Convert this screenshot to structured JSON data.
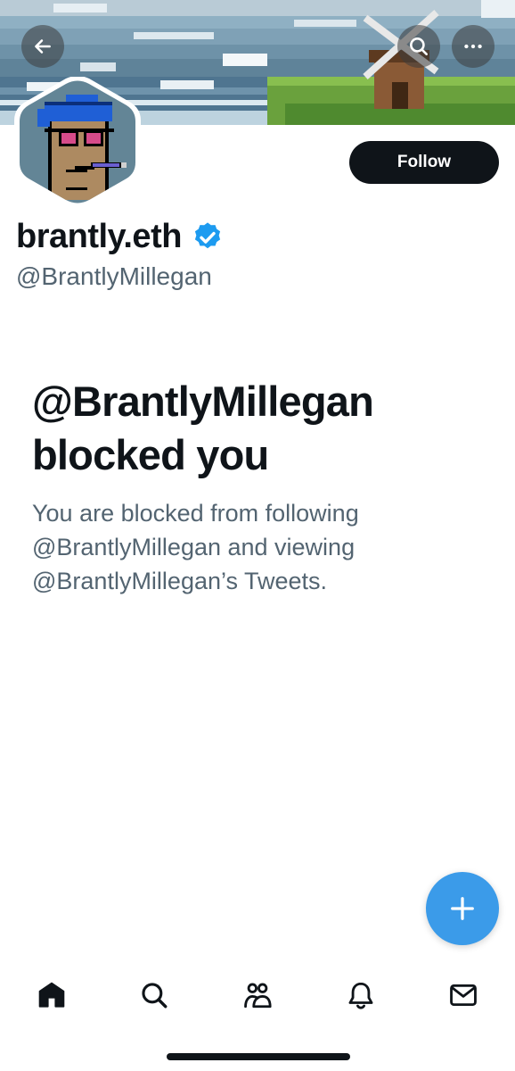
{
  "profile": {
    "display_name": "brantly.eth",
    "handle": "@BrantlyMillegan",
    "verified": true
  },
  "actions": {
    "follow_label": "Follow"
  },
  "blocked": {
    "title": "@BrantlyMillegan blocked you",
    "description": "You are blocked from following @BrantlyMillegan and viewing @BrantlyMillegan’s Tweets."
  },
  "icons": {
    "back": "arrow-left-icon",
    "search": "search-icon",
    "more": "more-horizontal-icon",
    "compose": "plus-icon",
    "nav": [
      "home-icon",
      "search-icon",
      "communities-icon",
      "bell-icon",
      "mail-icon"
    ]
  },
  "colors": {
    "accent": "#1d9bf0",
    "fab": "#3b9be9",
    "text_primary": "#0f1419",
    "text_secondary": "#536471"
  }
}
